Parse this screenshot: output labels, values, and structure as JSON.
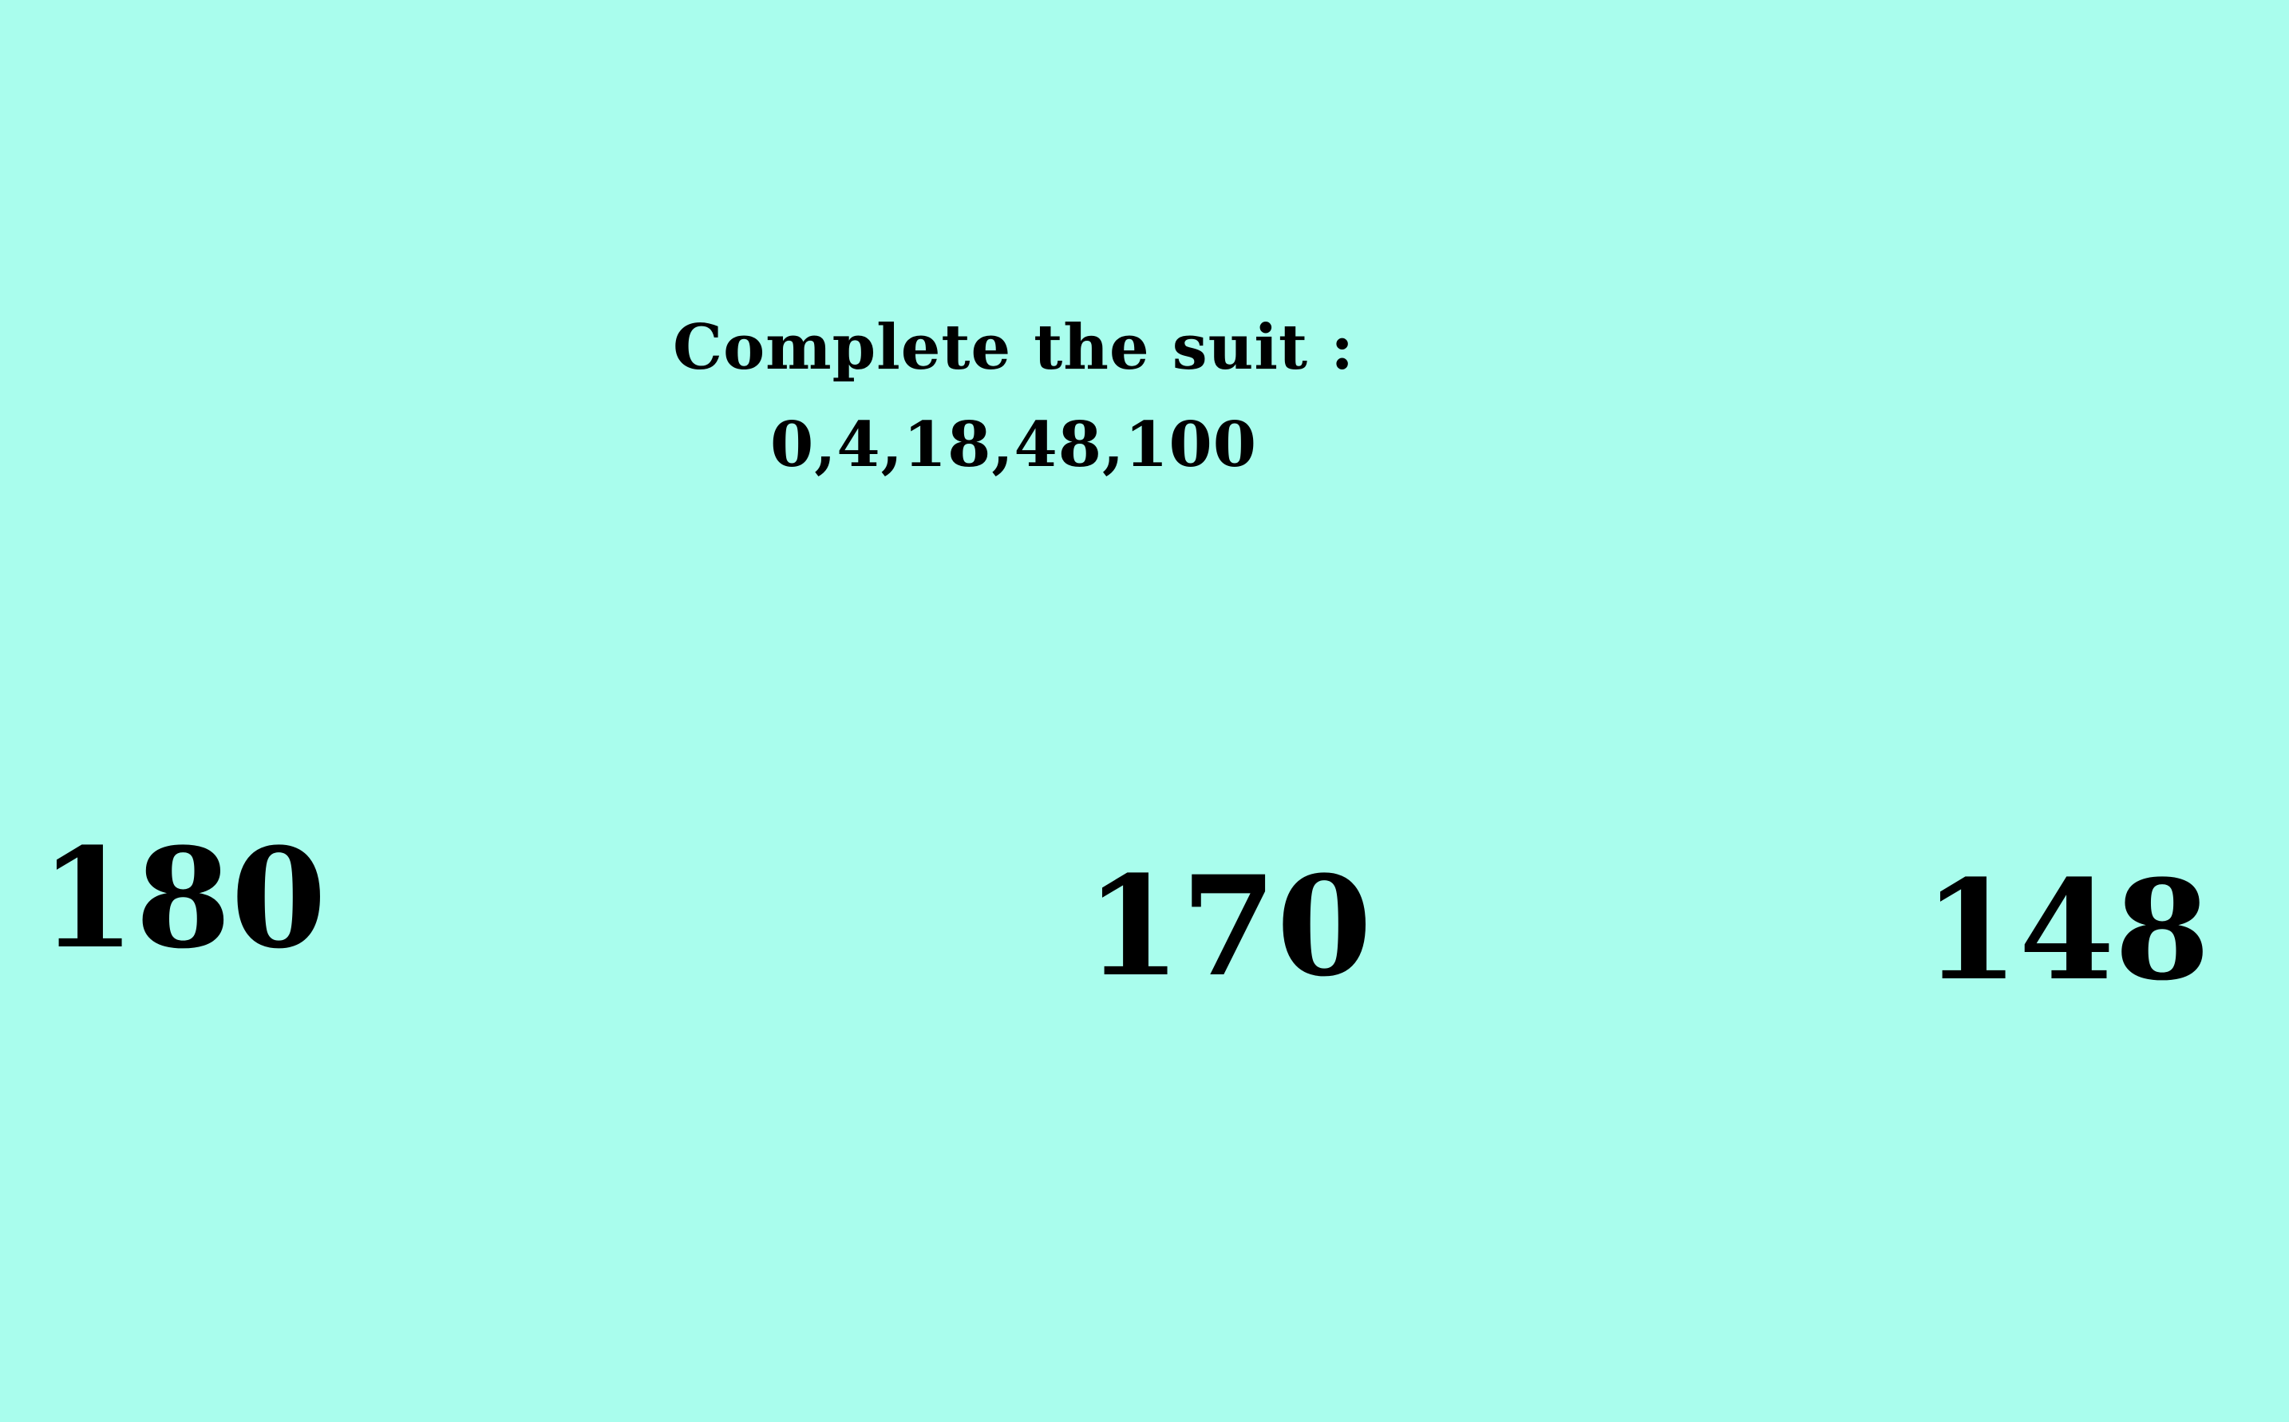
{
  "theme": {
    "background": "#A9FDED",
    "text": "#000000"
  },
  "question": {
    "line1": "Complete the suit :",
    "line2": "0,4,18,48,100"
  },
  "answers": [
    {
      "label": "180"
    },
    {
      "label": "170"
    },
    {
      "label": "148"
    }
  ]
}
